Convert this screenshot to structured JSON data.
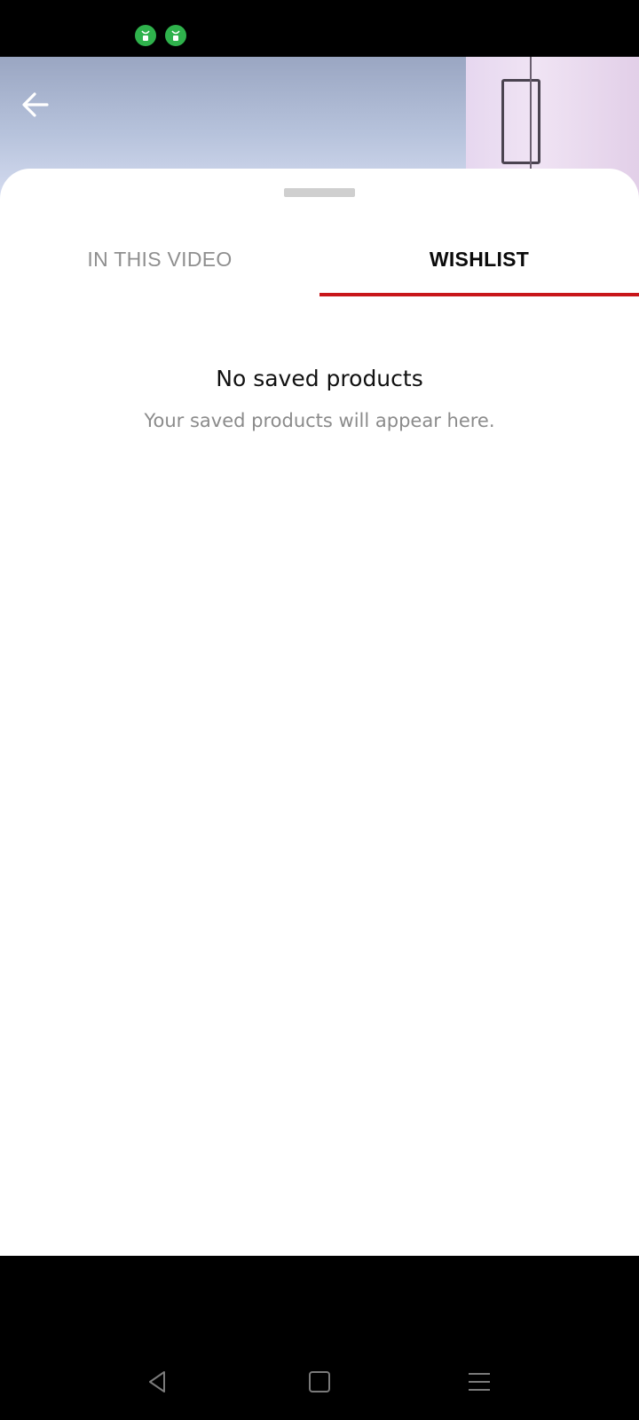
{
  "status_bar": {
    "icons": [
      "android-notification-icon",
      "android-notification-icon"
    ],
    "icon_color": "#2fb24c"
  },
  "header": {
    "back_icon": "arrow-left-icon"
  },
  "tabs": [
    {
      "label": "IN THIS VIDEO",
      "selected": false
    },
    {
      "label": "WISHLIST",
      "selected": true
    }
  ],
  "accent_color": "#c8161a",
  "empty_state": {
    "title": "No saved products",
    "subtitle": "Your saved products will appear here."
  },
  "nav_bar": {
    "buttons": [
      "back-triangle-icon",
      "home-square-icon",
      "menu-lines-icon"
    ]
  }
}
